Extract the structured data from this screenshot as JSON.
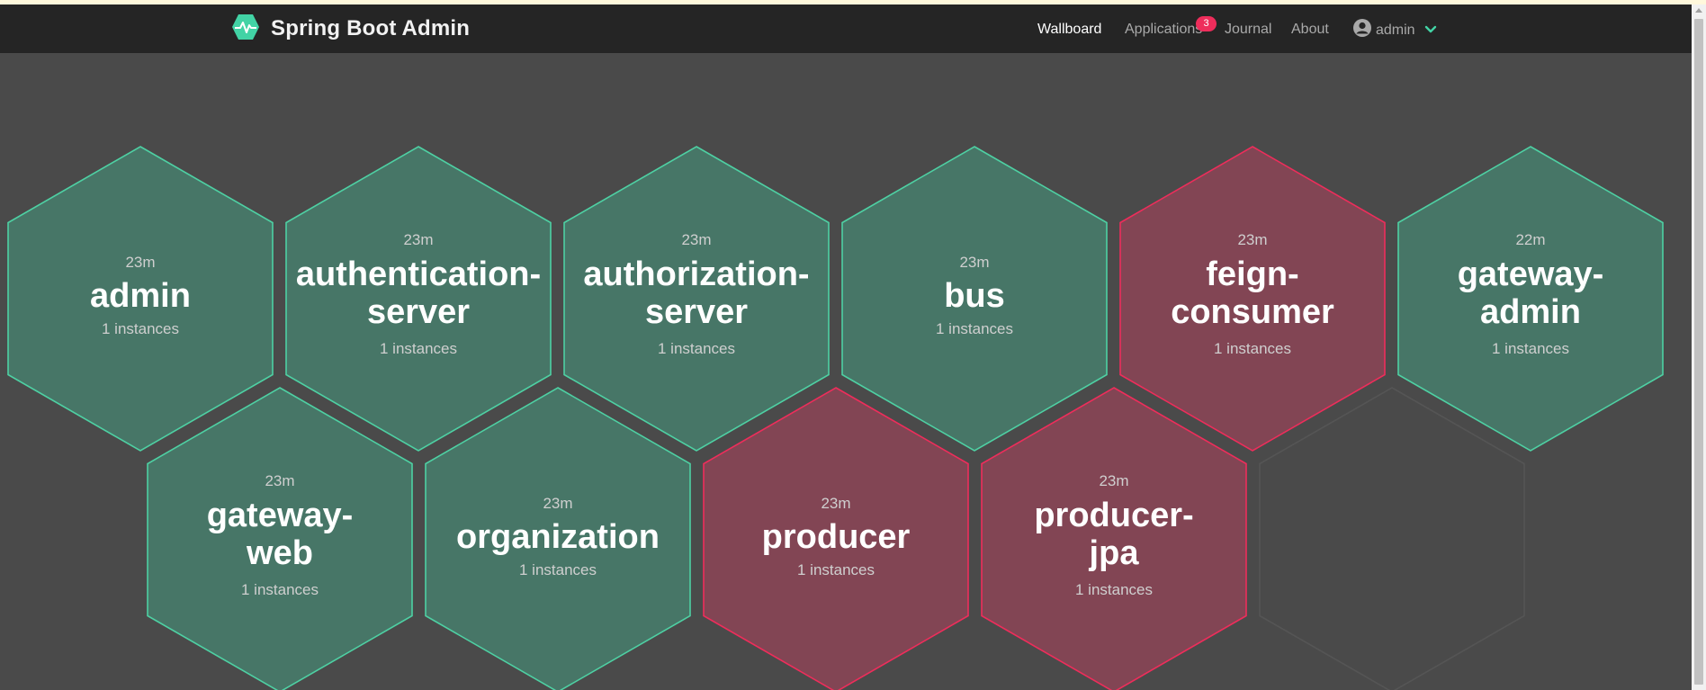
{
  "app": {
    "title": "Spring Boot Admin"
  },
  "nav": {
    "wallboard": "Wallboard",
    "applications": "Applications",
    "applications_badge": "3",
    "journal": "Journal",
    "about": "About",
    "user": "admin"
  },
  "colors": {
    "up_fill": "#477667",
    "up_stroke": "#4ed0a3",
    "down_fill": "#824554",
    "down_stroke": "#ee2d5b",
    "empty_stroke": "#555555",
    "brand": "#42d3a5"
  },
  "applications": [
    {
      "name": "admin",
      "name_lines": [
        "admin"
      ],
      "time": "23m",
      "instances": "1 instances",
      "status": "up"
    },
    {
      "name": "authentication-server",
      "name_lines": [
        "authentication-",
        "server"
      ],
      "time": "23m",
      "instances": "1 instances",
      "status": "up"
    },
    {
      "name": "authorization-server",
      "name_lines": [
        "authorization-",
        "server"
      ],
      "time": "23m",
      "instances": "1 instances",
      "status": "up"
    },
    {
      "name": "bus",
      "name_lines": [
        "bus"
      ],
      "time": "23m",
      "instances": "1 instances",
      "status": "up"
    },
    {
      "name": "feign-consumer",
      "name_lines": [
        "feign-",
        "consumer"
      ],
      "time": "23m",
      "instances": "1 instances",
      "status": "down"
    },
    {
      "name": "gateway-admin",
      "name_lines": [
        "gateway-",
        "admin"
      ],
      "time": "22m",
      "instances": "1 instances",
      "status": "up"
    },
    {
      "name": "gateway-web",
      "name_lines": [
        "gateway-",
        "web"
      ],
      "time": "23m",
      "instances": "1 instances",
      "status": "up"
    },
    {
      "name": "organization",
      "name_lines": [
        "organization"
      ],
      "time": "23m",
      "instances": "1 instances",
      "status": "up"
    },
    {
      "name": "producer",
      "name_lines": [
        "producer"
      ],
      "time": "23m",
      "instances": "1 instances",
      "status": "down"
    },
    {
      "name": "producer-jpa",
      "name_lines": [
        "producer-",
        "jpa"
      ],
      "time": "23m",
      "instances": "1 instances",
      "status": "down"
    },
    {
      "name": "",
      "name_lines": [],
      "time": "",
      "instances": "",
      "status": "empty"
    }
  ]
}
